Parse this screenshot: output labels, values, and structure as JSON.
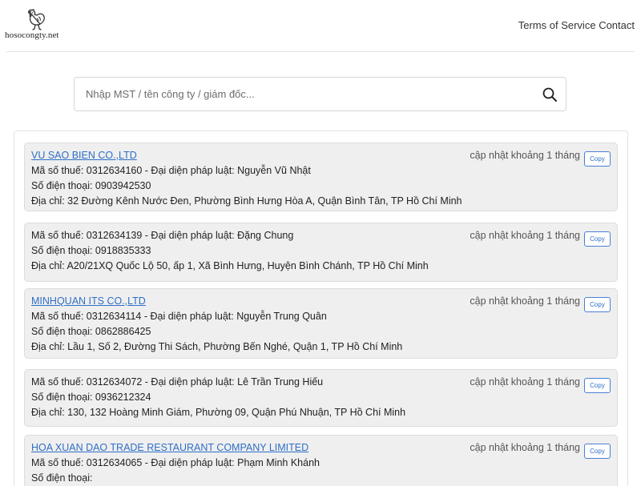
{
  "header": {
    "logo_text": "hosocongty.net",
    "nav": {
      "terms": "Terms of Service",
      "contact": "Contact"
    }
  },
  "search": {
    "placeholder": "Nhập MST / tên công ty / giám đốc...",
    "value": ""
  },
  "labels": {
    "copy": "Copy"
  },
  "results": [
    {
      "name": "VU SAO BIEN CO.,LTD",
      "tax_line": "Mã số thuế: 0312634160 - Đại diện pháp luật: Nguyễn Vũ Nhật",
      "phone_line": "Số điện thoại: 0903942530",
      "address_line": "Địa chỉ: 32 Đường Kênh Nước Đen, Phường Bình Hưng Hòa A, Quận Bình Tân, TP Hồ Chí Minh",
      "updated": "cập nhật khoảng 1 tháng"
    },
    {
      "name": "",
      "tax_line": "Mã số thuế: 0312634139 - Đại diện pháp luật: Đặng Chung",
      "phone_line": "Số điện thoại: 0918835333",
      "address_line": "Địa chỉ: A20/21XQ Quốc Lộ 50, ấp 1, Xã Bình Hưng, Huyện Bình Chánh, TP Hồ Chí Minh",
      "updated": "cập nhật khoảng 1 tháng"
    },
    {
      "name": "MINHQUAN ITS CO.,LTD",
      "tax_line": "Mã số thuế: 0312634114 - Đại diện pháp luật: Nguyễn Trung Quân",
      "phone_line": "Số điện thoại: 0862886425",
      "address_line": "Địa chỉ: Lầu 1, Số 2, Đường Thi Sách, Phường Bến Nghé, Quận 1, TP Hồ Chí Minh",
      "updated": "cập nhật khoảng 1 tháng"
    },
    {
      "name": "",
      "tax_line": "Mã số thuế: 0312634072 - Đại diện pháp luật: Lê Trần Trung Hiếu",
      "phone_line": "Số điện thoại: 0936212324",
      "address_line": "Địa chỉ: 130, 132 Hoàng Minh Giám, Phường 09, Quận Phú Nhuận, TP Hồ Chí Minh",
      "updated": "cập nhật khoảng 1 tháng"
    },
    {
      "name": "HOA XUAN DAO TRADE RESTAURANT COMPANY LIMITED",
      "tax_line": "Mã số thuế: 0312634065 - Đại diện pháp luật: Phạm Minh Khánh",
      "phone_line": "Số điện thoại:",
      "address_line": "",
      "updated": "cập nhật khoảng 1 tháng"
    }
  ]
}
